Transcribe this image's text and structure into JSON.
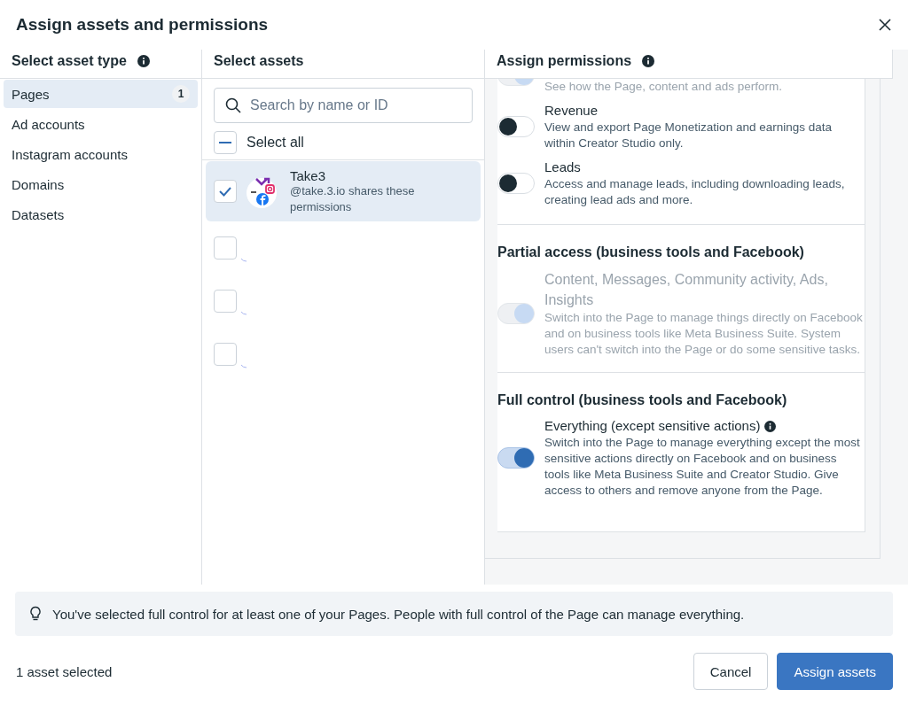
{
  "dialog": {
    "title": "Assign assets and permissions"
  },
  "asset_types": {
    "heading": "Select asset type",
    "items": [
      {
        "label": "Pages",
        "count": "1",
        "selected": true
      },
      {
        "label": "Ad accounts",
        "selected": false
      },
      {
        "label": "Instagram accounts",
        "selected": false
      },
      {
        "label": "Domains",
        "selected": false
      },
      {
        "label": "Datasets",
        "selected": false
      }
    ]
  },
  "assets": {
    "heading": "Select assets",
    "search": {
      "placeholder": "Search by name or ID"
    },
    "select_all": {
      "label": "Select all",
      "indeterminate": true
    },
    "items": [
      {
        "kind": "page",
        "name": "Take3",
        "subtitle": "@take.3.io shares these permissions",
        "checked": true
      },
      {
        "kind": "loading",
        "checked": false
      },
      {
        "kind": "loading",
        "checked": false
      },
      {
        "kind": "loading",
        "checked": false
      }
    ]
  },
  "permissions": {
    "heading": "Assign permissions",
    "sections": [
      {
        "items": [
          {
            "description": "See how the Page, content and ads perform.",
            "on": true,
            "disabled": true
          },
          {
            "title": "Revenue",
            "description": "View and export Page Monetization and earnings data within Creator Studio only.",
            "on": false,
            "disabled": false
          },
          {
            "title": "Leads",
            "description": "Access and manage leads, including downloading leads, creating lead ads and more.",
            "on": false,
            "disabled": false
          }
        ]
      },
      {
        "heading": "Partial access (business tools and Facebook)",
        "items": [
          {
            "title": "Content, Messages, Community activity, Ads, Insights",
            "description": "Switch into the Page to manage things directly on Facebook and on business tools like Meta Business Suite. System users can't switch into the Page or do some sensitive tasks.",
            "on": true,
            "disabled": true
          }
        ]
      },
      {
        "heading": "Full control (business tools and Facebook)",
        "items": [
          {
            "title": "Everything (except sensitive actions)",
            "info": true,
            "description": "Switch into the Page to manage everything except the most sensitive actions directly on Facebook and on business tools like Meta Business Suite and Creator Studio. Give access to others and remove anyone from the Page.",
            "on": true,
            "disabled": false
          }
        ]
      }
    ]
  },
  "notice": "You've selected full control for at least one of your Pages. People with full control of the Page can manage everything.",
  "footer": {
    "status": "1 asset selected",
    "buttons": [
      {
        "label": "Cancel",
        "kind": "secondary"
      },
      {
        "label": "Assign assets",
        "kind": "primary"
      }
    ]
  }
}
